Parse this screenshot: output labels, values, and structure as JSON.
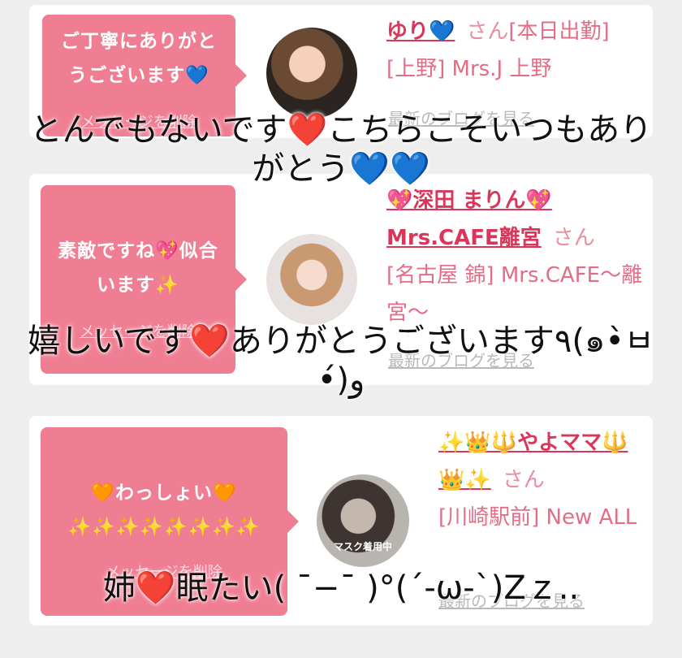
{
  "colors": {
    "bubble": "#f07e93",
    "name_link": "#d9365a",
    "info_text": "#e46d86",
    "blog_link": "#b9b9b9",
    "background": "#eeeeee"
  },
  "comments": [
    {
      "bubble_text": "ご丁寧にありがとうございます💙",
      "delete_label": "メッセージを削除",
      "avatar_icon": "avatar-woman-smiling",
      "name": "ゆり💙",
      "san": "さん",
      "status": "[本日出勤]",
      "shop": "[上野] Mrs.J 上野",
      "blog_label": "最新のブログを見る"
    },
    {
      "bubble_text": "素敵ですね💖似合います✨",
      "delete_label": "メッセージを削除",
      "avatar_icon": "avatar-woman-blonde",
      "name": "💖深田 まりん💖Mrs.CAFE離宮",
      "san": "さん",
      "shop": "[名古屋 錦] Mrs.CAFE〜離宮〜",
      "blog_label": "最新のブログを見る"
    },
    {
      "bubble_text": "🧡わっしょい🧡 ✨✨✨✨✨✨✨✨",
      "delete_label": "メッセージを削除",
      "avatar_icon": "avatar-woman-bottle",
      "avatar_caption": "マスク着用中",
      "name": "✨👑🔱やよママ🔱👑✨",
      "san": "さん",
      "shop": "[川崎駅前] New ALL",
      "blog_label": "最新のブログを見る"
    }
  ],
  "overlays": [
    "とんでもないです❤️こちらこそいつもありがとう💙💙",
    "嬉しいです❤️ありがとうございます٩(๑•̀ㅂ•́)و",
    "姉❤️眠たい( ¯−¯ )°(´-ω-`)Zｚ.."
  ]
}
